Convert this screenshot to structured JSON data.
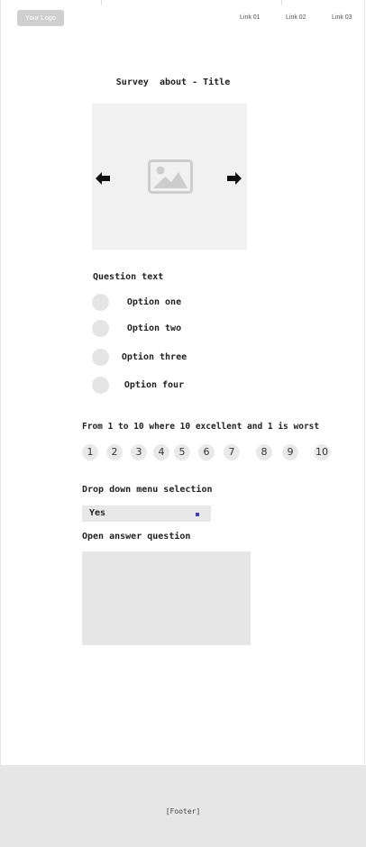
{
  "header": {
    "logo": "Your Logo",
    "links": [
      "Link 01",
      "Link 02",
      "Link 03"
    ]
  },
  "survey": {
    "title": "Survey  about - Title",
    "carousel": {
      "image_icon": "image-placeholder-icon",
      "prev_icon": "arrow-left-icon",
      "next_icon": "arrow-right-icon"
    },
    "question_text": "Question text",
    "options": [
      "Option one",
      "Option two",
      "Option three",
      "Option four"
    ],
    "scale_question": "From 1 to 10 where 10 excellent and 1 is worst",
    "scale_values": [
      "1",
      "2",
      "3",
      "4",
      "5",
      "6",
      "7",
      "8",
      "9",
      "10"
    ],
    "dropdown_label": "Drop down menu selection",
    "dropdown_value": "Yes",
    "open_question": "Open answer question",
    "open_answer_value": ""
  },
  "footer": {
    "text": "[Footer]"
  },
  "colors": {
    "placeholder_gray": "#e6e6e6",
    "logo_bg": "#cfcfcf",
    "dropdown_caret": "#3b3bc4"
  }
}
